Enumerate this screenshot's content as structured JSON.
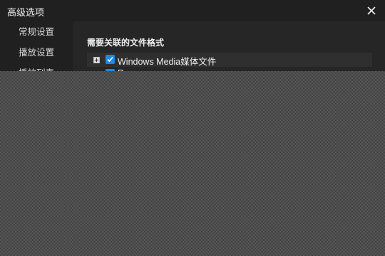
{
  "window": {
    "title": "高级选项",
    "close_icon": "close-icon"
  },
  "sidebar": {
    "items": [
      {
        "label": "常规设置"
      },
      {
        "label": "播放设置"
      },
      {
        "label": "播放列表"
      }
    ]
  },
  "main": {
    "section_title": "需要关联的文件格式",
    "tree": [
      {
        "label": "Windows Media媒体文件",
        "checked": true,
        "expander": "plus"
      },
      {
        "label": "R",
        "checked": true,
        "expander": "plus"
      }
    ]
  },
  "colors": {
    "accent": "#1e88e5",
    "background": "#262626",
    "sidebar": "#202020"
  }
}
